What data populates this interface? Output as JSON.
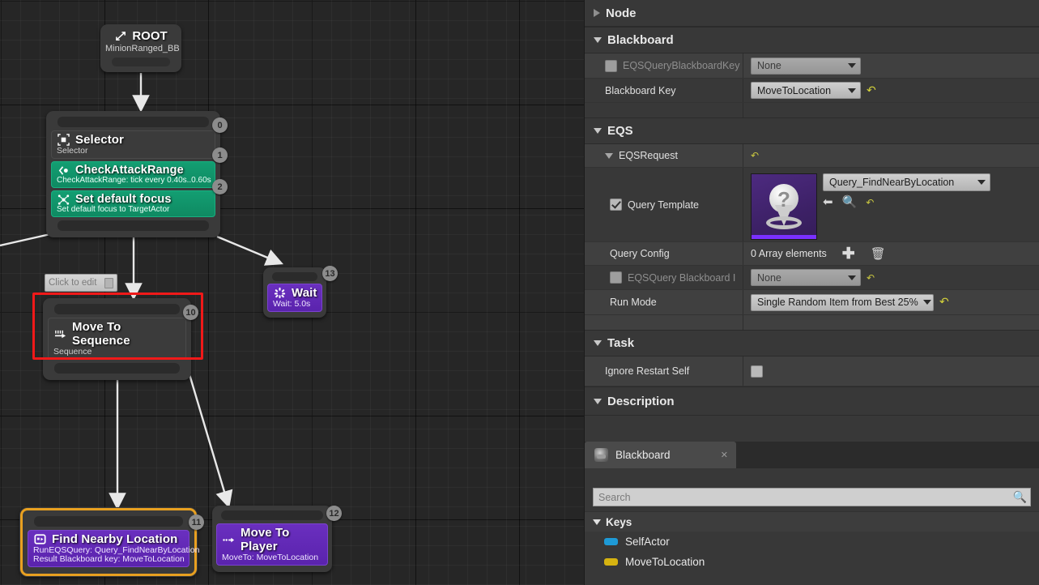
{
  "graph": {
    "nodes": [
      {
        "id": "root",
        "title": "ROOT",
        "subtitle": "MinionRanged_BB",
        "icon": "root-icon",
        "index": ""
      },
      {
        "id": "selector",
        "title": "Selector",
        "subtitle": "Selector",
        "icon": "selector-icon",
        "index": "0",
        "decorators": [
          {
            "title": "CheckAttackRange",
            "subtitle": "CheckAttackRange: tick every 0.40s..0.60s",
            "icon": "blackboard-decorator-icon",
            "index": "1"
          },
          {
            "title": "Set default focus",
            "subtitle": "Set default focus to TargetActor",
            "icon": "focus-service-icon",
            "index": "2"
          }
        ]
      },
      {
        "id": "move-to-sequence",
        "title": "Move To Sequence",
        "subtitle": "Sequence",
        "icon": "sequence-icon",
        "index": "10",
        "selected_highlight": true
      },
      {
        "id": "wait",
        "title": "Wait",
        "subtitle": "Wait: 5.0s",
        "icon": "wait-icon",
        "index": "13"
      },
      {
        "id": "find-nearby-location",
        "title": "Find Nearby Location",
        "subtitle": "RunEQSQuery: Query_FindNearByLocation",
        "subtitle2": "Result Blackboard key: MoveToLocation",
        "icon": "run-eqs-query-icon",
        "index": "11",
        "selected": true
      },
      {
        "id": "move-to-player",
        "title": "Move To Player",
        "subtitle": "MoveTo: MoveToLocation",
        "icon": "move-to-icon",
        "index": "12"
      }
    ],
    "tooltip": {
      "label": "Click to edit"
    }
  },
  "details": {
    "categories": {
      "node": "Node",
      "blackboard": "Blackboard",
      "eqs": "EQS",
      "task": "Task",
      "description": "Description"
    },
    "rows": {
      "eqs_query_blackboard_key": {
        "label": "EQSQueryBlackboardKey",
        "value": "None"
      },
      "blackboard_key": {
        "label": "Blackboard Key",
        "value": "MoveToLocation"
      },
      "eqs_request": {
        "label": "EQSRequest"
      },
      "query_template": {
        "label": "Query Template",
        "value": "Query_FindNearByLocation"
      },
      "query_config": {
        "label": "Query Config",
        "value": "0 Array elements"
      },
      "eqs_query_blackboard_2": {
        "label": "EQSQuery Blackboard I",
        "value": "None"
      },
      "run_mode": {
        "label": "Run Mode",
        "value": "Single Random Item from Best 25%"
      },
      "ignore_restart_self": {
        "label": "Ignore Restart Self"
      }
    }
  },
  "blackboard_panel": {
    "tab_label": "Blackboard",
    "search_placeholder": "Search",
    "keys_header": "Keys",
    "keys": [
      {
        "name": "SelfActor",
        "color": "#1e9ad6"
      },
      {
        "name": "MoveToLocation",
        "color": "#d6b310"
      }
    ]
  },
  "colors": {
    "highlight": "#f01919",
    "selected_node": "#e8a020",
    "decorator_green": "#139e72",
    "task_purple": "#6a2fbf",
    "reset_yellow": "#d4d23a"
  }
}
